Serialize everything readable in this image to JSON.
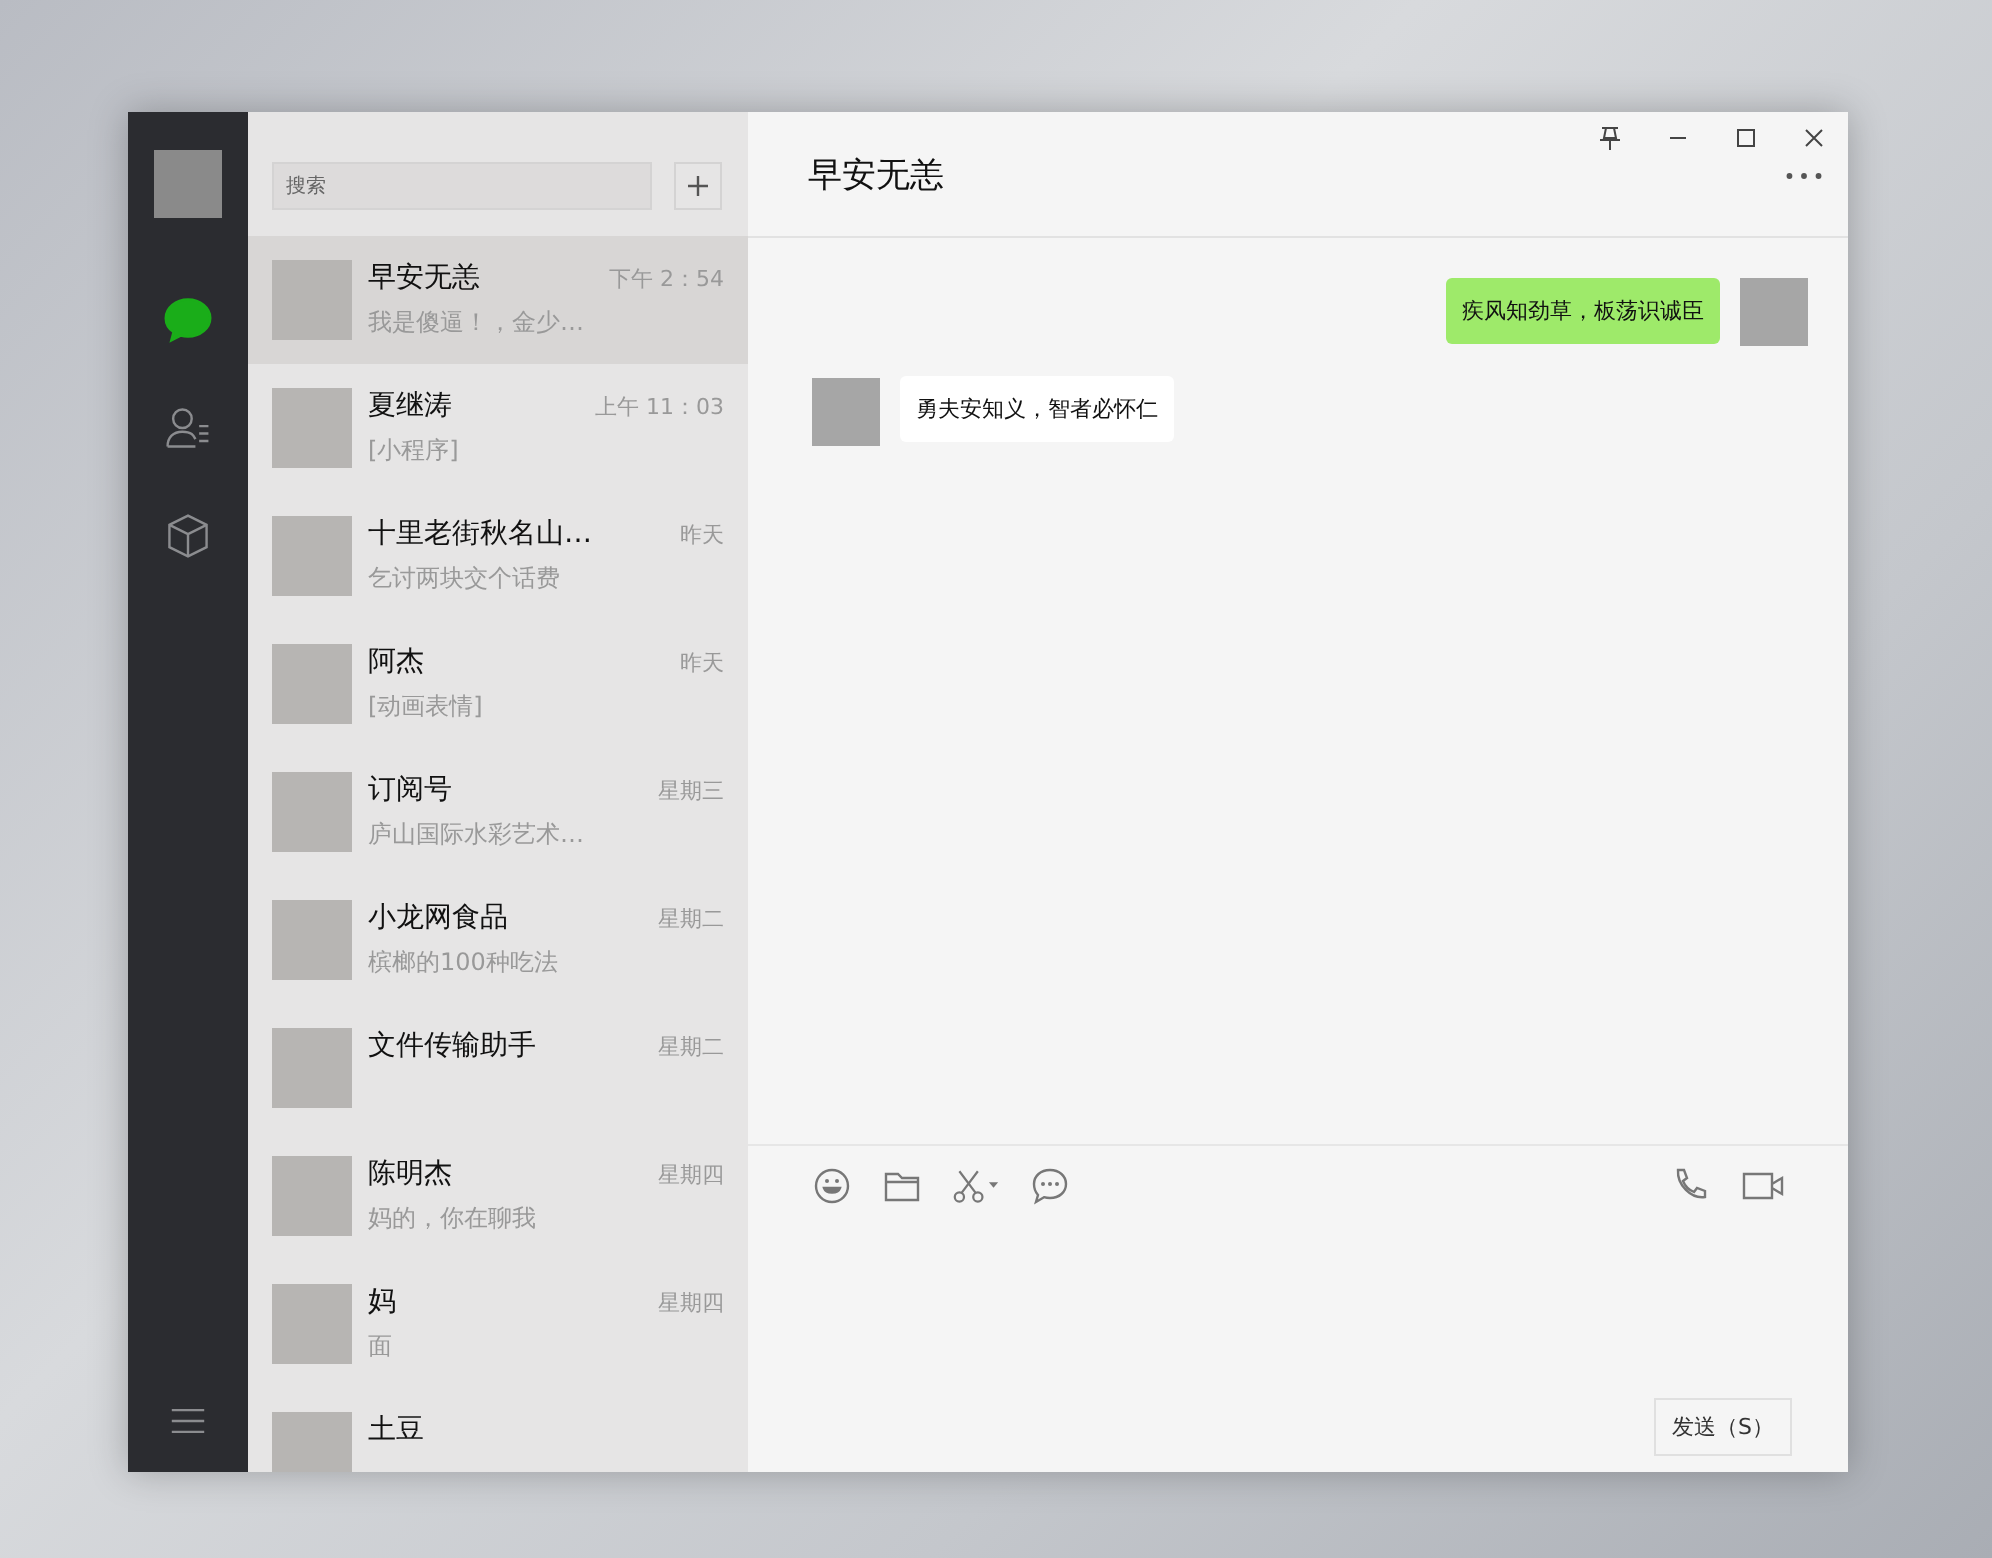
{
  "window": {
    "title": "早安无恙"
  },
  "sidebar": {
    "items": [
      {
        "kind": "chats",
        "selected": true
      },
      {
        "kind": "contacts",
        "selected": false
      },
      {
        "kind": "favorites",
        "selected": false
      }
    ]
  },
  "search": {
    "placeholder": "搜索"
  },
  "conversations": [
    {
      "name": "早安无恙",
      "preview": "我是傻逼！，金少…",
      "time": "下午 2：54",
      "selected": true
    },
    {
      "name": "夏继涛",
      "preview": "[小程序]",
      "time": "上午 11：03",
      "selected": false
    },
    {
      "name": "十里老街秋名山…",
      "preview": "乞讨两块交个话费",
      "time": "昨天",
      "selected": false
    },
    {
      "name": "阿杰",
      "preview": "[动画表情]",
      "time": "昨天",
      "selected": false
    },
    {
      "name": "订阅号",
      "preview": "庐山国际水彩艺术…",
      "time": "星期三",
      "selected": false
    },
    {
      "name": "小龙网食品",
      "preview": "槟榔的100种吃法",
      "time": "星期二",
      "selected": false
    },
    {
      "name": "文件传输助手",
      "time": "星期二",
      "selected": false
    },
    {
      "name": "陈明杰",
      "preview": "妈的，你在聊我",
      "time": "星期四",
      "selected": false
    },
    {
      "name": "妈",
      "preview": "面",
      "time": "星期四",
      "selected": false
    },
    {
      "name": "土豆",
      "selected": false
    }
  ],
  "messages": [
    {
      "kind": "sent",
      "text": "疾风知劲草，板荡识诚臣"
    },
    {
      "kind": "received",
      "text": "勇夫安知义，智者必怀仁"
    }
  ],
  "send_button": "发送（S）"
}
